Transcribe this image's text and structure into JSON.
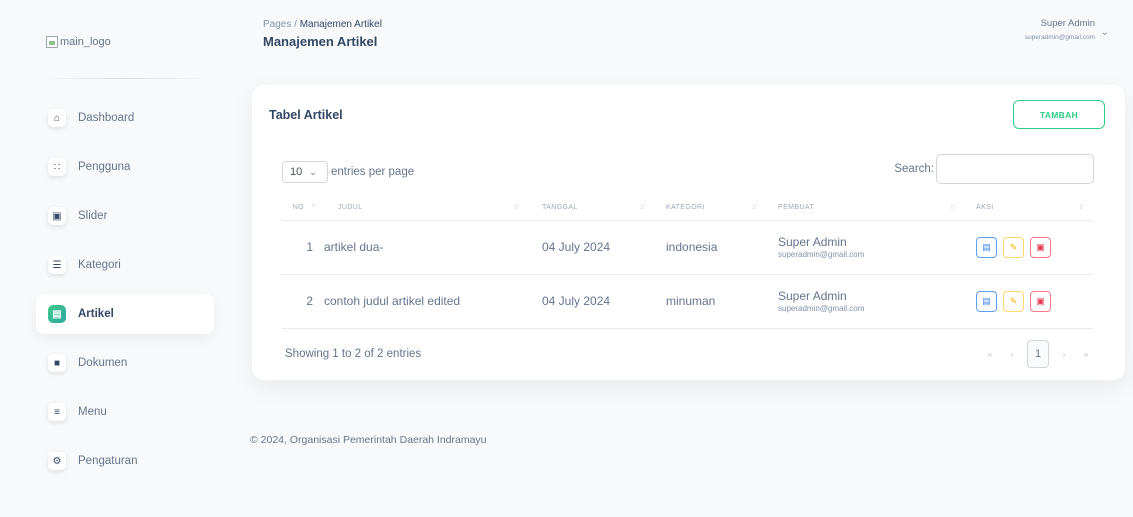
{
  "sidebar": {
    "logo_alt": "main_logo",
    "items": [
      {
        "label": "Dashboard",
        "icon": "home-icon",
        "glyph": "⌂",
        "active": false
      },
      {
        "label": "Pengguna",
        "icon": "users-icon",
        "glyph": "∷",
        "active": false
      },
      {
        "label": "Slider",
        "icon": "image-icon",
        "glyph": "▣",
        "active": false
      },
      {
        "label": "Kategori",
        "icon": "list-icon",
        "glyph": "☰",
        "active": false
      },
      {
        "label": "Artikel",
        "icon": "article-icon",
        "glyph": "▤",
        "active": true
      },
      {
        "label": "Dokumen",
        "icon": "document-icon",
        "glyph": "■",
        "active": false
      },
      {
        "label": "Menu",
        "icon": "menu-icon",
        "glyph": "≡",
        "active": false
      },
      {
        "label": "Pengaturan",
        "icon": "settings-icon",
        "glyph": "⚙",
        "active": false
      }
    ]
  },
  "header": {
    "breadcrumb_root": "Pages",
    "breadcrumb_sep": "/",
    "breadcrumb_current": "Manajemen Artikel",
    "title": "Manajemen Artikel",
    "user_name": "Super Admin",
    "user_email": "superadmin@gmail.com"
  },
  "card": {
    "title": "Tabel Artikel",
    "add_label": "TAMBAH",
    "entries_value": "10",
    "entries_suffix": "entries per page",
    "search_label": "Search:",
    "search_value": ""
  },
  "table": {
    "headers": [
      "NO",
      "JUDUL",
      "TANGGAL",
      "KATEGORI",
      "PEMBUAT",
      "AKSI"
    ],
    "rows": [
      {
        "no": "1",
        "judul": "artikel dua-",
        "tanggal": "04 July 2024",
        "kategori": "indonesia",
        "pembuat": "Super Admin",
        "email": "superadmin@gmail.com"
      },
      {
        "no": "2",
        "judul": "contoh judul artikel edited",
        "tanggal": "04 July 2024",
        "kategori": "minuman",
        "pembuat": "Super Admin",
        "email": "superadmin@gmail.com"
      }
    ]
  },
  "pagination": {
    "info": "Showing 1 to 2 of 2 entries",
    "first": "«",
    "prev": "‹",
    "current": "1",
    "next": "›",
    "last": "»"
  },
  "footer": {
    "text": "© 2024, Organisasi Pemerintah Daerah Indramayu"
  },
  "colors": {
    "accent": "#2dce89",
    "title": "#344767",
    "text": "#67748e"
  }
}
